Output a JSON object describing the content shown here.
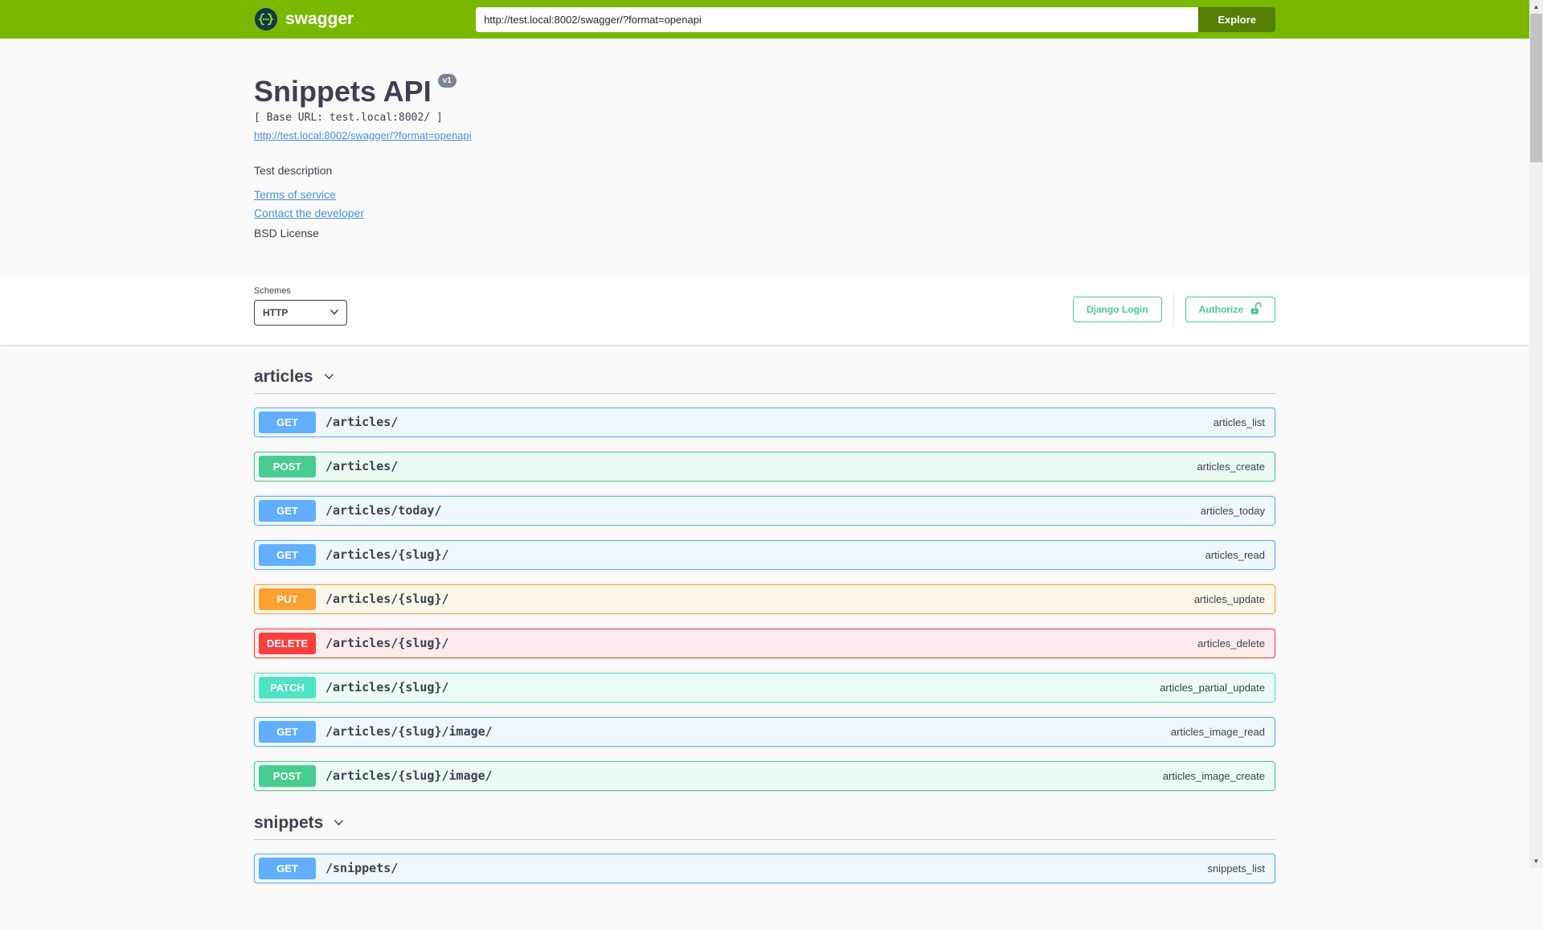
{
  "topbar": {
    "logo_text": "swagger",
    "url_value": "http://test.local:8002/swagger/?format=openapi",
    "explore_label": "Explore"
  },
  "info": {
    "title": "Snippets API",
    "version_badge": "v1",
    "base_url": "[ Base URL: test.local:8002/ ]",
    "spec_link": "http://test.local:8002/swagger/?format=openapi",
    "description": "Test description",
    "terms_label": "Terms of service",
    "contact_label": "Contact the developer",
    "license": "BSD License"
  },
  "schemes": {
    "label": "Schemes",
    "selected": "HTTP",
    "django_login_label": "Django Login",
    "authorize_label": "Authorize"
  },
  "sections": [
    {
      "tag": "articles",
      "operations": [
        {
          "method": "GET",
          "path": "/articles/",
          "op_id": "articles_list"
        },
        {
          "method": "POST",
          "path": "/articles/",
          "op_id": "articles_create"
        },
        {
          "method": "GET",
          "path": "/articles/today/",
          "op_id": "articles_today"
        },
        {
          "method": "GET",
          "path": "/articles/{slug}/",
          "op_id": "articles_read"
        },
        {
          "method": "PUT",
          "path": "/articles/{slug}/",
          "op_id": "articles_update"
        },
        {
          "method": "DELETE",
          "path": "/articles/{slug}/",
          "op_id": "articles_delete"
        },
        {
          "method": "PATCH",
          "path": "/articles/{slug}/",
          "op_id": "articles_partial_update"
        },
        {
          "method": "GET",
          "path": "/articles/{slug}/image/",
          "op_id": "articles_image_read"
        },
        {
          "method": "POST",
          "path": "/articles/{slug}/image/",
          "op_id": "articles_image_create"
        }
      ]
    },
    {
      "tag": "snippets",
      "operations": [
        {
          "method": "GET",
          "path": "/snippets/",
          "op_id": "snippets_list"
        }
      ]
    }
  ],
  "method_styles": {
    "GET": {
      "color": "#61affe",
      "bg": "#eff7ff"
    },
    "POST": {
      "color": "#49cc90",
      "bg": "#edfaf4"
    },
    "PUT": {
      "color": "#fca130",
      "bg": "#fff6eb"
    },
    "DELETE": {
      "color": "#f93e3e",
      "bg": "#feebeb"
    },
    "PATCH": {
      "color": "#50e3c2",
      "bg": "#ebfcf9"
    }
  },
  "theme": {
    "topbar_bg": "#7ab800",
    "explore_bg": "#547f00",
    "accent": "#49cc90",
    "link_color": "#4990e2",
    "text_color": "#3b4151"
  },
  "icons": {
    "scroll_up": "▲",
    "scroll_down": "▼"
  }
}
